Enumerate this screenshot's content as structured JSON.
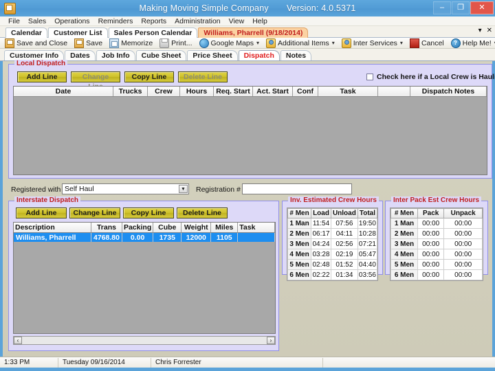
{
  "window": {
    "title": "Making Moving Simple Company",
    "version": "Version: 4.0.5371",
    "minimize": "–",
    "maximize": "❐",
    "close": "✕"
  },
  "menu": [
    "File",
    "Sales",
    "Operations",
    "Reminders",
    "Reports",
    "Administration",
    "View",
    "Help"
  ],
  "doc_tabs": {
    "items": [
      {
        "label": "Calendar",
        "active": false
      },
      {
        "label": "Customer List",
        "active": false
      },
      {
        "label": "Sales Person Calendar",
        "active": false
      },
      {
        "label": "Williams, Pharrell  (9/18/2014)",
        "active": true
      }
    ],
    "dropdown": "▾",
    "close": "✕"
  },
  "toolbar": [
    {
      "label": "Save and Close",
      "icon": "save-icon",
      "caret": false
    },
    {
      "label": "Save",
      "icon": "save-icon",
      "caret": false
    },
    {
      "label": "Memorize",
      "icon": "memorize-icon",
      "caret": false
    },
    {
      "label": "Print...",
      "icon": "print-icon",
      "caret": false
    },
    {
      "label": "Google Maps",
      "icon": "globe-icon",
      "caret": true
    },
    {
      "label": "Additional Items",
      "icon": "people-icon",
      "caret": true
    },
    {
      "label": "Inter Services",
      "icon": "people-icon",
      "caret": true
    },
    {
      "label": "Cancel",
      "icon": "cancel-icon",
      "caret": false
    },
    {
      "label": "Help Me!",
      "icon": "help-icon",
      "caret": true
    }
  ],
  "sub_tabs": [
    {
      "label": "Customer Info",
      "active": false
    },
    {
      "label": "Dates",
      "active": false
    },
    {
      "label": "Job Info",
      "active": false
    },
    {
      "label": "Cube Sheet",
      "active": false
    },
    {
      "label": "Price Sheet",
      "active": false
    },
    {
      "label": "Dispatch",
      "active": true
    },
    {
      "label": "Notes",
      "active": false
    }
  ],
  "local_dispatch": {
    "title": "Local Dispatch",
    "buttons": [
      {
        "label": "Add Line",
        "disabled": false
      },
      {
        "label": "Change Line",
        "disabled": true
      },
      {
        "label": "Copy Line",
        "disabled": false
      },
      {
        "label": "Delete Line",
        "disabled": true
      }
    ],
    "checkbox_label": "Check here if a Local Crew is Hauling",
    "checkbox_checked": false,
    "columns": [
      "Date",
      "Trucks",
      "Crew",
      "Hours",
      "Req. Start",
      "Act. Start",
      "Conf",
      "Task",
      "",
      "Dispatch Notes"
    ],
    "rows": []
  },
  "registered": {
    "label": "Registered with",
    "value": "Self Haul",
    "arrow": "▼",
    "reg_number_label": "Registration #",
    "reg_number_value": ""
  },
  "interstate_dispatch": {
    "title": "Interstate Dispatch",
    "buttons": [
      {
        "label": "Add Line",
        "disabled": false
      },
      {
        "label": "Change Line",
        "disabled": false
      },
      {
        "label": "Copy Line",
        "disabled": false
      },
      {
        "label": "Delete Line",
        "disabled": false
      }
    ],
    "columns": [
      "Description",
      "Trans",
      "Packing",
      "Cube",
      "Weight",
      "Miles",
      "Task"
    ],
    "rows": [
      {
        "selected": true,
        "cells": [
          "Williams, Pharrell",
          "4768.80",
          "0.00",
          "1735",
          "12000",
          "1105",
          ""
        ]
      }
    ],
    "scroll_left": "‹",
    "scroll_right": "›"
  },
  "inv_hours": {
    "title": "Inv. Estimated Crew Hours",
    "columns": [
      "# Men",
      "Load",
      "Unload",
      "Total"
    ],
    "rows": [
      [
        "1 Man",
        "11:54",
        "07:56",
        "19:50"
      ],
      [
        "2 Men",
        "06:17",
        "04:11",
        "10:28"
      ],
      [
        "3 Men",
        "04:24",
        "02:56",
        "07:21"
      ],
      [
        "4 Men",
        "03:28",
        "02:19",
        "05:47"
      ],
      [
        "5 Men",
        "02:48",
        "01:52",
        "04:40"
      ],
      [
        "6 Men",
        "02:22",
        "01:34",
        "03:56"
      ]
    ]
  },
  "pack_hours": {
    "title": "Inter Pack Est Crew Hours",
    "columns": [
      "# Men",
      "Pack",
      "Unpack"
    ],
    "rows": [
      [
        "1 Man",
        "00:00",
        "00:00"
      ],
      [
        "2 Men",
        "00:00",
        "00:00"
      ],
      [
        "3 Men",
        "00:00",
        "00:00"
      ],
      [
        "4 Men",
        "00:00",
        "00:00"
      ],
      [
        "5 Men",
        "00:00",
        "00:00"
      ],
      [
        "6 Men",
        "00:00",
        "00:00"
      ]
    ]
  },
  "statusbar": {
    "time": "1:33 PM",
    "date": "Tuesday 09/16/2014",
    "user": "Chris Forrester"
  },
  "colors": {
    "title_bar": "#539dd6",
    "group_bg": "#ddd9f8",
    "group_border": "#8f8fe8",
    "group_title": "#c01d1d",
    "button_gold": "#cfc22c",
    "selection": "#1d8ef0",
    "active_tab": "#fbd2a2",
    "body_bg": "#d2cfbc"
  }
}
